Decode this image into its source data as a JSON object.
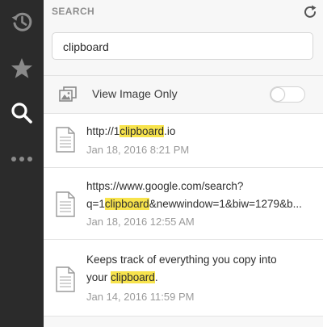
{
  "sidebar": {
    "items": [
      {
        "icon": "history-icon"
      },
      {
        "icon": "star-icon"
      },
      {
        "icon": "search-icon"
      },
      {
        "icon": "more-icon"
      }
    ]
  },
  "header": {
    "title": "SEARCH",
    "refresh_icon": "refresh-icon"
  },
  "search": {
    "value": "clipboard",
    "placeholder": ""
  },
  "view_image_only": {
    "label": "View Image Only",
    "enabled": false
  },
  "results": [
    {
      "line1_pre": "http://1",
      "line1_hl": "clipboard",
      "line1_post": ".io",
      "date": "Jan 18, 2016 8:21 PM"
    },
    {
      "line1": "https://www.google.com/search?",
      "line2_pre": "q=1",
      "line2_hl": "clipboard",
      "line2_post": "&newwindow=1&biw=1279&b...",
      "date": "Jan 18, 2016 12:55 AM"
    },
    {
      "line1": "Keeps track of everything you copy into",
      "line2_pre": "your ",
      "line2_hl": "clipboard",
      "line2_post": ".",
      "date": "Jan 14, 2016 11:59 PM"
    }
  ],
  "colors": {
    "sidebar_bg": "#2b2b2b",
    "sidebar_icon": "#8a8a8a",
    "sidebar_active_icon": "#ffffff",
    "highlight": "#f7e34c"
  }
}
